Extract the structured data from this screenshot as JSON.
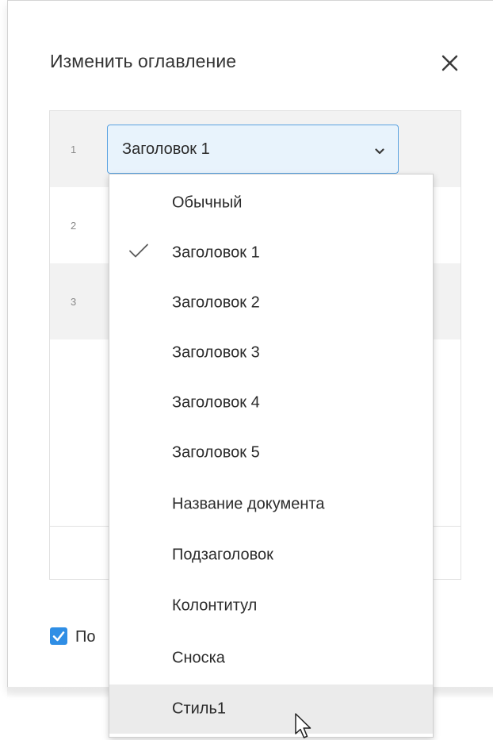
{
  "dialog": {
    "title": "Изменить оглавление",
    "close_icon": "close-icon"
  },
  "table": {
    "rows": [
      {
        "number": "1"
      },
      {
        "number": "2"
      },
      {
        "number": "3"
      }
    ]
  },
  "style_select": {
    "value": "Заголовок 1",
    "icon": "chevron-down-icon"
  },
  "checkbox": {
    "checked": true,
    "label": "По"
  },
  "menu": {
    "selected_index": 1,
    "hovered_index": 10,
    "items": [
      {
        "label": "Обычный"
      },
      {
        "label": "Заголовок 1"
      },
      {
        "label": "Заголовок 2"
      },
      {
        "label": "Заголовок 3"
      },
      {
        "label": "Заголовок 4"
      },
      {
        "label": "Заголовок 5"
      },
      {
        "label": "Название документа"
      },
      {
        "label": "Подзаголовок"
      },
      {
        "label": "Колонтитул"
      },
      {
        "label": "Сноска"
      },
      {
        "label": "Стиль1"
      }
    ]
  },
  "colors": {
    "accent": "#2f8ee5",
    "select_bg": "#e8f3fc",
    "hover_bg": "#ebebeb"
  }
}
